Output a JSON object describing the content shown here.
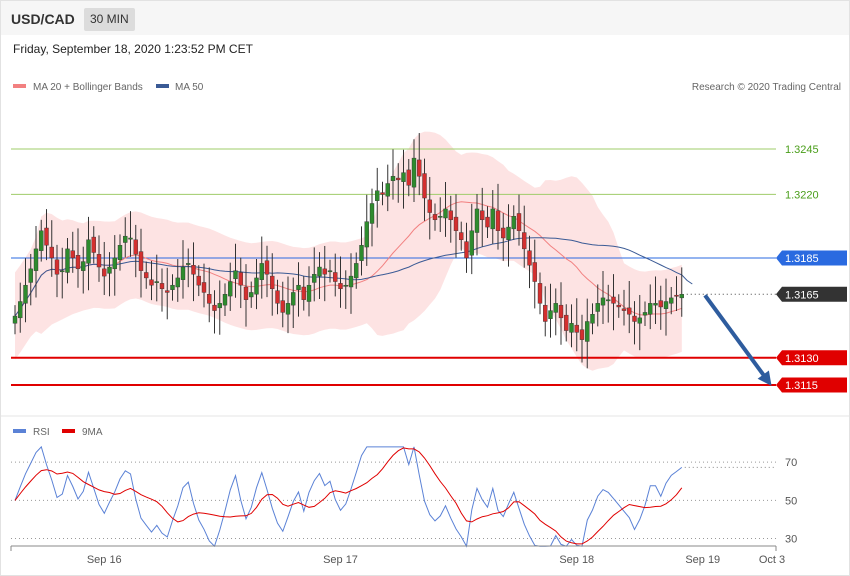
{
  "header": {
    "pair": "USD/CAD",
    "timeframe": "30 MIN"
  },
  "timestamp": "Friday, September 18, 2020 1:23:52 PM CET",
  "copyright": "Research © 2020 Trading Central",
  "legend": {
    "ma20_bb": "MA 20 + Bollinger Bands",
    "ma50": "MA 50",
    "rsi": "RSI",
    "rsi_ma": "9MA"
  },
  "colors": {
    "bollinger_fill": "#fde3e3",
    "ma20": "#f28080",
    "ma50": "#3a5a95",
    "up_candle": "#2e8b2e",
    "down_candle": "#d32f2f",
    "resistance": "#9fcc6a",
    "pivot": "#2a6ae0",
    "support": "#e00000",
    "current": "#333333",
    "arrow": "#2e5c9e",
    "rsi": "#5b82d6",
    "rsi_ma": "#e00000"
  },
  "chart_data": [
    {
      "type": "candlestick",
      "ylim": [
        1.3104,
        1.3272
      ],
      "x_ticks": [
        "Sep 16",
        "Sep 17",
        "Sep 18",
        "Sep 19",
        "Oct 3"
      ],
      "levels": [
        {
          "value": 1.3245,
          "label": "1.3245",
          "kind": "resistance"
        },
        {
          "value": 1.322,
          "label": "1.3220",
          "kind": "resistance"
        },
        {
          "value": 1.3185,
          "label": "1.3185",
          "kind": "pivot"
        },
        {
          "value": 1.3165,
          "label": "1.3165",
          "kind": "current"
        },
        {
          "value": 1.313,
          "label": "1.3130",
          "kind": "support"
        },
        {
          "value": 1.3115,
          "label": "1.3115",
          "kind": "support"
        }
      ],
      "arrow": {
        "from": 1.3165,
        "to": 1.3115
      },
      "close": [
        1.3153,
        1.3161,
        1.317,
        1.3179,
        1.319,
        1.32,
        1.3192,
        1.3185,
        1.3176,
        1.3178,
        1.319,
        1.3185,
        1.3179,
        1.3183,
        1.3195,
        1.3188,
        1.318,
        1.3175,
        1.318,
        1.3185,
        1.3192,
        1.3197,
        1.3196,
        1.3187,
        1.3178,
        1.3174,
        1.317,
        1.3172,
        1.3168,
        1.3166,
        1.317,
        1.3174,
        1.318,
        1.3182,
        1.3176,
        1.317,
        1.3166,
        1.316,
        1.3156,
        1.316,
        1.3165,
        1.3172,
        1.3178,
        1.317,
        1.3162,
        1.3166,
        1.3174,
        1.3182,
        1.3176,
        1.3168,
        1.316,
        1.3155,
        1.316,
        1.3166,
        1.317,
        1.3162,
        1.317,
        1.3176,
        1.318,
        1.3176,
        1.3178,
        1.3172,
        1.3168,
        1.317,
        1.3175,
        1.3182,
        1.3192,
        1.3205,
        1.3215,
        1.3222,
        1.322,
        1.3226,
        1.323,
        1.3228,
        1.3232,
        1.3225,
        1.324,
        1.323,
        1.3218,
        1.321,
        1.3206,
        1.3208,
        1.3212,
        1.3206,
        1.32,
        1.3195,
        1.3185,
        1.32,
        1.3212,
        1.3206,
        1.3202,
        1.3212,
        1.32,
        1.3196,
        1.3202,
        1.3208,
        1.32,
        1.319,
        1.3181,
        1.3172,
        1.316,
        1.315,
        1.3156,
        1.316,
        1.3152,
        1.3145,
        1.3149,
        1.3144,
        1.314,
        1.315,
        1.3154,
        1.316,
        1.3163,
        1.3162,
        1.316,
        1.3158,
        1.3156,
        1.3154,
        1.315,
        1.3152,
        1.3155,
        1.316,
        1.316,
        1.3158,
        1.3161,
        1.3163,
        1.3164,
        1.3165
      ],
      "moving_averages": [
        "MA 20 + Bollinger Bands",
        "MA 50"
      ]
    },
    {
      "type": "line",
      "name": "RSI",
      "ylim": [
        24,
        79
      ],
      "y_ticks": [
        30,
        50,
        70
      ],
      "series": [
        "RSI",
        "9MA"
      ]
    }
  ]
}
